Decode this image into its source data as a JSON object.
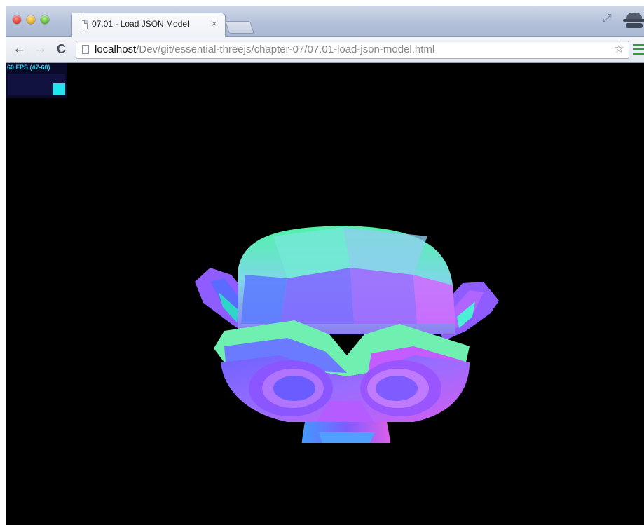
{
  "browser": {
    "tab": {
      "title": "07.01 - Load JSON Model",
      "close_glyph": "×"
    },
    "address_bar": {
      "host": "localhost",
      "path": "/Dev/git/essential-threejs/chapter-07/07.01-load-json-model.html"
    },
    "icons": {
      "back": "←",
      "forward": "→",
      "reload": "C",
      "star": "☆",
      "fullscreen": "⤢"
    }
  },
  "stats": {
    "fps_text": "60 FPS (47-60)",
    "fps_level": 0.55
  },
  "colors": {
    "background": "#000000",
    "fps_text": "#20d8e8",
    "fps_panel": "#0a0a2a",
    "menu_green": "#2f9e34"
  }
}
